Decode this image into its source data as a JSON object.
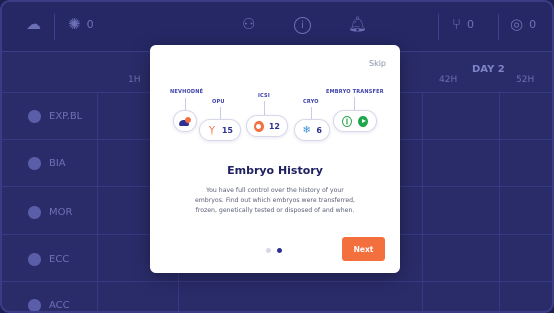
{
  "background": {
    "topbar": {
      "counter_left": "0",
      "counter_right_1": "0",
      "counter_right_2": "0"
    },
    "grid": {
      "day_label": "DAY 2",
      "col_headers": [
        "1H",
        "42H",
        "52H"
      ],
      "rows": [
        "EXP.BL",
        "BIA",
        "MOR",
        "ECC",
        "ACC"
      ]
    }
  },
  "modal": {
    "skip_label": "Skip",
    "timeline": [
      {
        "label": "NEVHODNÉ",
        "count": ""
      },
      {
        "label": "OPU",
        "count": "15"
      },
      {
        "label": "ICSI",
        "count": "12"
      },
      {
        "label": "CRYO",
        "count": "6"
      },
      {
        "label": "EMBRYO TRANSFER",
        "count": ""
      }
    ],
    "title": "Embryo History",
    "body": "You have full control over the history of your embryos. Find out which embryos were transferred, frozen, genetically tested or disposed of and when.",
    "next_label": "Next",
    "pagination": {
      "current": 2,
      "total": 2
    }
  },
  "colors": {
    "accent": "#f36f3e",
    "primary": "#2d3193",
    "backdrop": "#2a2c6a"
  }
}
